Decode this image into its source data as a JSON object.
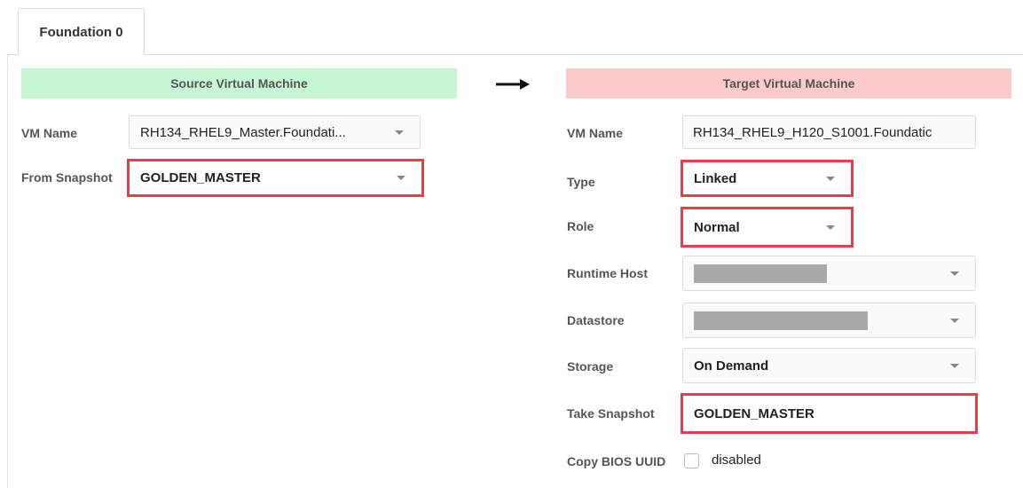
{
  "tab": {
    "label": "Foundation 0"
  },
  "source": {
    "header": "Source Virtual Machine",
    "vm_name_label": "VM Name",
    "vm_name_value": "RH134_RHEL9_Master.Foundati...",
    "snapshot_label": "From Snapshot",
    "snapshot_value": "GOLDEN_MASTER"
  },
  "target": {
    "header": "Target Virtual Machine",
    "vm_name_label": "VM Name",
    "vm_name_value": "RH134_RHEL9_H120_S1001.Foundatic",
    "type_label": "Type",
    "type_value": "Linked",
    "role_label": "Role",
    "role_value": "Normal",
    "runtime_host_label": "Runtime Host",
    "datastore_label": "Datastore",
    "storage_label": "Storage",
    "storage_value": "On Demand",
    "take_snapshot_label": "Take Snapshot",
    "take_snapshot_value": "GOLDEN_MASTER",
    "copy_bios_label": "Copy BIOS UUID",
    "copy_bios_value": "disabled"
  },
  "colors": {
    "source_header_bg": "#c7f6d5",
    "target_header_bg": "#fccaca",
    "highlight": "#e53e46"
  },
  "icons": {
    "arrow": "right-arrow-icon",
    "dropdown": "chevron-down-icon"
  }
}
